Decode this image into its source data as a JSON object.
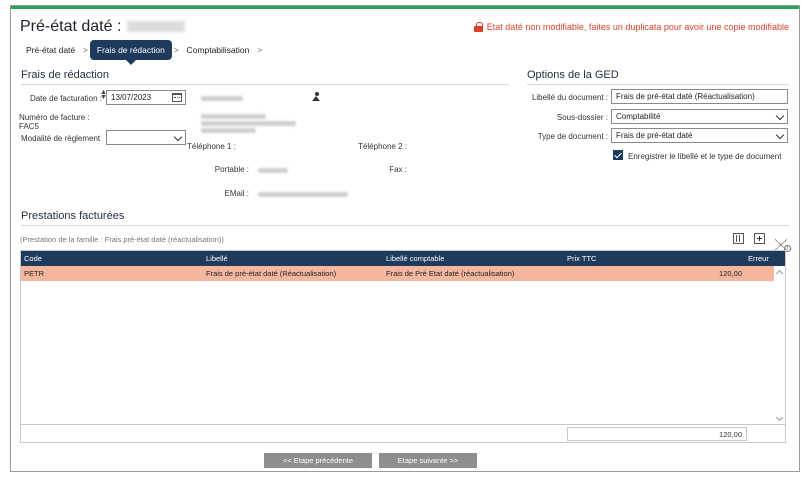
{
  "header": {
    "title": "Pré-état daté :",
    "warning": "Etat daté non modifiable, faites un duplicata pour avoir une copie modifiable"
  },
  "breadcrumbs": [
    "Pré-état daté",
    "Frais de rédaction",
    "Comptabilisation"
  ],
  "frais": {
    "section_title": "Frais de rédaction",
    "date_label": "Date de facturation :",
    "date_value": "13/07/2023",
    "numero_label": "Numéro de facture :",
    "numero_value": "FAC5",
    "modalite_label": "Modalité de règlement",
    "modalite_value": "",
    "tel1_label": "Téléphone 1 :",
    "tel2_label": "Téléphone 2 :",
    "portable_label": "Portable :",
    "fax_label": "Fax :",
    "email_label": "EMail :"
  },
  "ged": {
    "section_title": "Options de la GED",
    "libelle_label": "Libellé du document :",
    "libelle_value": "Frais de pré-état daté (Réactualisation)",
    "sousdossier_label": "Sous-dossier :",
    "sousdossier_value": "Comptabilité",
    "type_label": "Type de document :",
    "type_value": "Frais de pré-état daté",
    "checkbox_label": "Enregistrer le libellé et le type de document"
  },
  "prestations": {
    "section_title": "Prestations facturées",
    "family_note": "(Prestation de la famille : Frais pré-état daté (réactualisation))",
    "columns": [
      "Code",
      "Libellé",
      "Libellé comptable",
      "Prix TTC",
      "Erreur"
    ],
    "rows": [
      {
        "code": "PETR",
        "libelle": "Frais de pré-état daté (Réactualisation)",
        "libelle_comptable": "Frais de Pré Etat daté (réactualisation)",
        "prix": "120,00",
        "erreur": ""
      }
    ],
    "total": "120,00"
  },
  "footer": {
    "prev_label": "<< Etape précédente",
    "next_label": "Etape suivante >>"
  },
  "colors": {
    "accent_navy": "#1e3a5c",
    "warning_red": "#d9412b",
    "row_highlight": "#f4b79e",
    "top_bar_green": "#27a35a"
  }
}
